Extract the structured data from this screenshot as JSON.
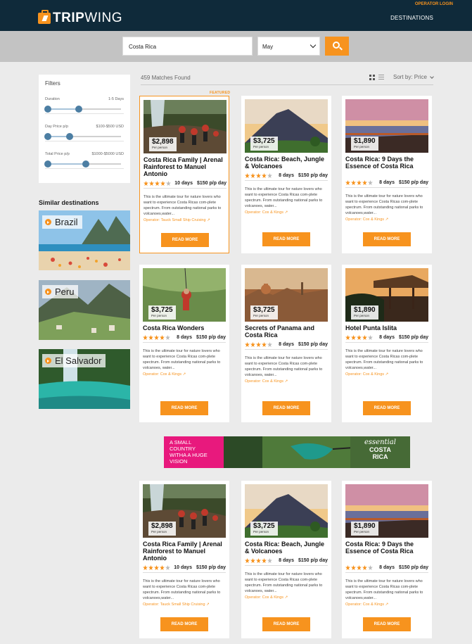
{
  "header": {
    "brand_part1": "TRIP",
    "brand_part2": "WING",
    "operator_login": "OPERATOR LOGIN",
    "nav_destinations": "DESTINATIONS"
  },
  "search": {
    "query": "Costa Rica",
    "month": "May"
  },
  "filters": {
    "title": "Filters",
    "items": [
      {
        "label": "Duration",
        "value": "1-5 Days",
        "lo": 0,
        "hi": 0.42
      },
      {
        "label": "Day Price p/p",
        "value": "$100-$500 USD",
        "lo": 0,
        "hi": 0.3
      },
      {
        "label": "Total Price p/p",
        "value": "$1000-$5000 USD",
        "lo": 0,
        "hi": 0.52
      }
    ]
  },
  "similar": {
    "title": "Similar destinations",
    "items": [
      "Brazil",
      "Peru",
      "El Salvador"
    ]
  },
  "results": {
    "count_label": "459 Matches Found",
    "sort_label": "Sort by: Price",
    "featured_label": "FEATURED"
  },
  "cards": [
    {
      "price": "$2,898",
      "per": "Per person",
      "title": "Costa Rica Family | Arenal Rainforest to Manuel Antonio",
      "rating": 4,
      "days": "10 days",
      "dayprice": "$150 p/p day",
      "desc": "This is the ultimate tour for nature lovers who want to experience Costa Ricas com-plete spectrum. From outstanding national parks to volcanoes,water...",
      "operator": "Operator: Tauck Small Ship Cruising",
      "button": "READ MORE",
      "image": "canyon"
    },
    {
      "price": "$3,725",
      "per": "Per person",
      "title": "Costa Rica: Beach, Jungle & Volcanoes",
      "rating": 4,
      "days": "8 days",
      "dayprice": "$150 p/p day",
      "desc": "This is the ultimate tour for nature lovers who want to experience Costa Ricas com-plete spectrum. From outstanding national parks to volcanoes, water...",
      "operator": "Operator: Cox & Kings",
      "button": "READ MORE",
      "image": "volcano"
    },
    {
      "price": "$1,890",
      "per": "Per person",
      "title": "Costa Rica: 9 Days the Essence of Costa Rica",
      "rating": 4,
      "days": "8 days",
      "dayprice": "$150 p/p day",
      "desc": "This is the ultimate tour for nature lovers who want to experience Costa Ricas com-plete spectrum. From outstanding national parks to volcanoes,water...",
      "operator": "Operator: Cox & Kings",
      "button": "READ MORE",
      "image": "lake"
    },
    {
      "price": "$3,725",
      "per": "Per person",
      "title": "Costa Rica Wonders",
      "rating": 4,
      "days": "8 days",
      "dayprice": "$150 p/p day",
      "desc": "This is the ultimate tour for nature lovers who want to experience Costa Ricas com-plete spectrum. From outstanding national parks to volcanoes, water...",
      "operator": "Operator: Cox & Kings",
      "button": "READ MORE",
      "image": "zipline"
    },
    {
      "price": "$3,725",
      "per": "Per person",
      "title": "Secrets of Panama and Costa Rica",
      "rating": 4,
      "days": "8 days",
      "dayprice": "$150 p/p day",
      "desc": "This is the ultimate tour for nature lovers who want to experience Costa Ricas com-plete spectrum. From outstanding national parks to volcanoes, water...",
      "operator": "Operator: Cox & Kings",
      "button": "READ MORE",
      "image": "city"
    },
    {
      "price": "$1,890",
      "per": "Per person",
      "title": "Hotel Punta Islita",
      "rating": 4,
      "days": "8 days",
      "dayprice": "$150 p/p day",
      "desc": "This is the ultimate tour for nature lovers who want to experience Costa Ricas com-plete spectrum. From outstanding national parks to volcanoes,water...",
      "operator": "Operator: Cox & Kings",
      "button": "READ MORE",
      "image": "hotel"
    },
    {
      "price": "$2,898",
      "per": "Per person",
      "title": "Costa Rica Family | Arenal Rainforest to Manuel Antonio",
      "rating": 4,
      "days": "10 days",
      "dayprice": "$150 p/p day",
      "desc": "This is the ultimate tour for nature lovers who want to experience Costa Ricas com-plete spectrum. From outstanding national parks to volcanoes,water...",
      "operator": "Operator: Tauck Small Ship Cruising",
      "button": "READ MORE",
      "image": "canyon"
    },
    {
      "price": "$3,725",
      "per": "Per person",
      "title": "Costa Rica: Beach, Jungle & Volcanoes",
      "rating": 4,
      "days": "8 days",
      "dayprice": "$150 p/p day",
      "desc": "This is the ultimate tour for nature lovers who want to experience Costa Ricas com-plete spectrum. From outstanding national parks to volcanoes, water...",
      "operator": "Operator: Cox & Kings",
      "button": "READ MORE",
      "image": "volcano"
    },
    {
      "price": "$1,890",
      "per": "Per person",
      "title": "Costa Rica: 9 Days the Essence of Costa Rica",
      "rating": 4,
      "days": "8 days",
      "dayprice": "$150 p/p day",
      "desc": "This is the ultimate tour for nature lovers who want to experience Costa Ricas com-plete spectrum. From outstanding national parks to volcanoes,water...",
      "operator": "Operator: Cox & Kings",
      "button": "READ MORE",
      "image": "lake"
    }
  ],
  "banner": {
    "line1": "A SMALL",
    "line2": "COUNTRY",
    "line3": "WITHA A HUGE",
    "line4": "VISION",
    "brand1": "essential",
    "brand2": "COSTA",
    "brand3": "RICA"
  },
  "colors": {
    "accent": "#f7931e",
    "header": "#0f2a3a",
    "slider": "#4c7ea3"
  }
}
